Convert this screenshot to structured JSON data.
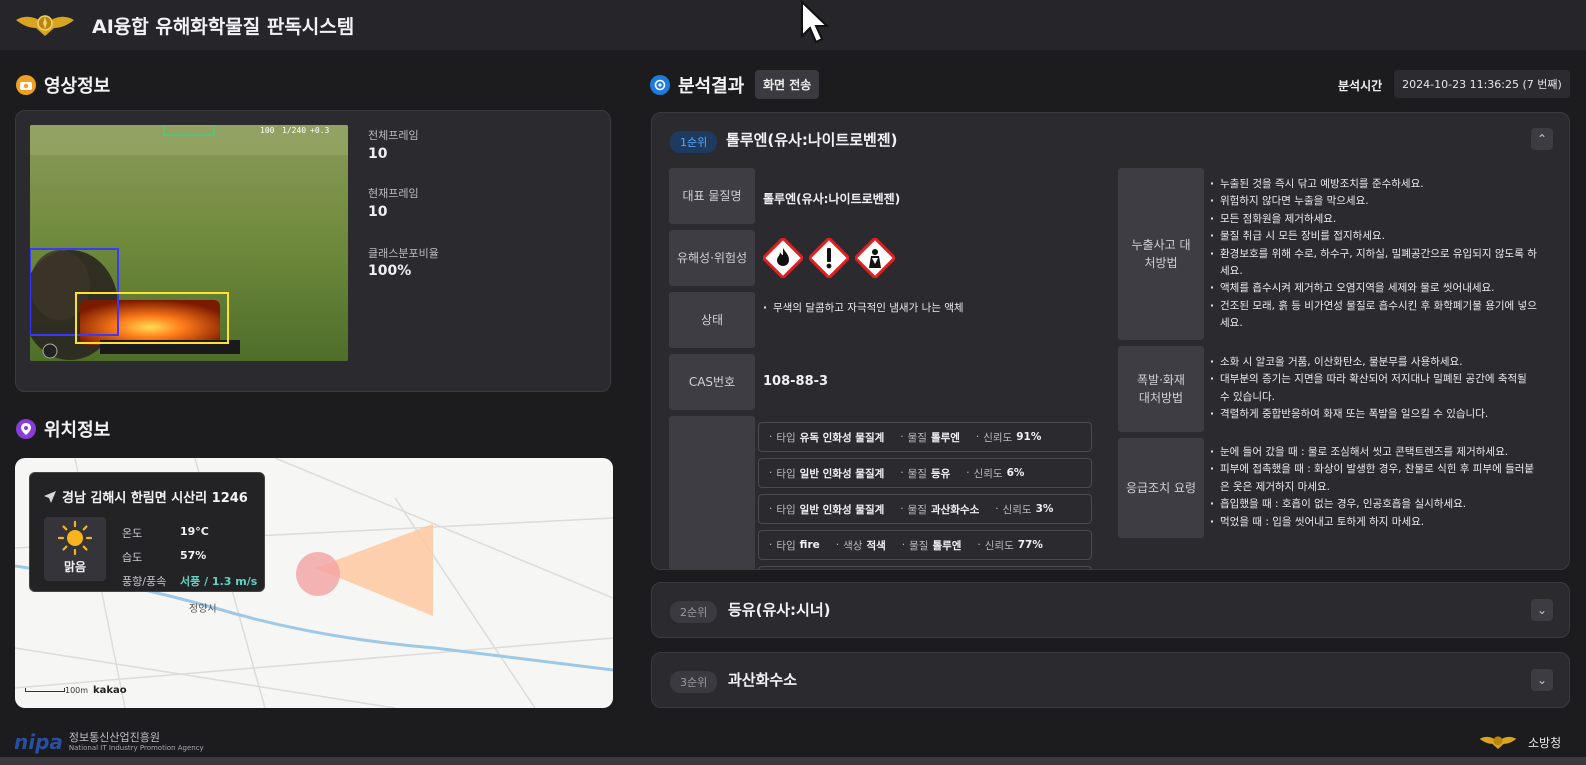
{
  "app": {
    "title": "AI융합 유해화학물질 판독시스템"
  },
  "video_info": {
    "section_title": "영상정보",
    "total_frame_label": "전체프레임",
    "total_frame_value": "10",
    "current_frame_label": "현재프레임",
    "current_frame_value": "10",
    "class_ratio_label": "클래스분포비율",
    "class_ratio_value": "100%",
    "overlay": {
      "shutter": "100",
      "speed": "1/240",
      "ev": "+0.3"
    }
  },
  "location_info": {
    "section_title": "위치정보",
    "address": "경남 김해시 한림면 시산리 1246",
    "weather_label": "맑음",
    "temp_label": "온도",
    "temp_value": "19°C",
    "humidity_label": "습도",
    "humidity_value": "57%",
    "wind_label": "풍향/풍속",
    "wind_value": "서풍 / 1.3 m/s",
    "map_place": "정양시",
    "map_scale": "100m",
    "map_brand": "kakao"
  },
  "analysis": {
    "section_title": "분석결과",
    "send_button": "화면 전송",
    "time_label": "분석시간",
    "time_value": "2024-10-23 11:36:25  (7 번째)",
    "results": [
      {
        "rank": "1순위",
        "name": "톨루엔(유사:나이트로벤젠)",
        "expanded": true,
        "rep_name_label": "대표 물질명",
        "rep_name_value": "톨루엔(유사:나이트로벤젠)",
        "hazard_label": "유해성·위험성",
        "hazard_icons": [
          "flame-icon",
          "exclamation-icon",
          "health-hazard-icon"
        ],
        "state_label": "상태",
        "state_value": "무색의 달콤하고 자극적인 냄새가 나는 액체",
        "cas_label": "CAS번호",
        "cas_value": "108-88-3",
        "leak_label": "누출사고 대처방법",
        "leak_items": [
          "누출된 것을 즉시 닦고 예방조치를 준수하세요.",
          "위험하지 않다면 누출을 막으세요.",
          "모든 점화원을 제거하세요.",
          "물질 취급 시 모든 장비를 접지하세요.",
          "환경보호를 위해 수로, 하수구, 지하실, 밀폐공간으로 유입되지 않도록 하세요.",
          "액체를 흡수시켜 제거하고 오염지역을 세제와 물로 씻어내세요.",
          "건조된 모래, 흙 등 비가연성 물질로 흡수시킨 후 화학폐기물 용기에 넣으세요."
        ],
        "fire_label": "폭발·화재 대처방법",
        "fire_items": [
          "소화 시 알코올 거품, 이산화탄소, 물분무를 사용하세요.",
          "대부분의 증기는 지면을 따라 확산되어 저지대나 밀폐된 공간에 축적될 수 있습니다.",
          "격렬하게 중합반응하여 화재 또는 폭발을 일으킬 수 있습니다."
        ],
        "first_aid_label": "응급조치 요령",
        "first_aid_items": [
          "눈에 들어 갔을 때 : 물로 조심해서 씻고 콘택트렌즈를 제거하세요.",
          "피부에 접촉했을 때 : 화상이 발생한 경우, 찬물로 식힌 후 피부에 들러붙은 옷은 제거하지 마세요.",
          "흡입했을 때 : 호흡이 없는 경우, 인공호흡을 실시하세요.",
          "먹었을 때 : 입을 씻어내고 토하게 하지 마세요."
        ],
        "detections": [
          {
            "type_label": "타입",
            "type": "유독 인화성 물질계",
            "mat_label": "물질",
            "mat": "톨루엔",
            "conf_label": "신뢰도",
            "conf": "91%"
          },
          {
            "type_label": "타입",
            "type": "일반 인화성 물질계",
            "mat_label": "물질",
            "mat": "등유",
            "conf_label": "신뢰도",
            "conf": "6%"
          },
          {
            "type_label": "타입",
            "type": "일반 인화성 물질계",
            "mat_label": "물질",
            "mat": "과산화수소",
            "conf_label": "신뢰도",
            "conf": "3%"
          },
          {
            "type_label": "타입",
            "type": "fire",
            "color_label": "색상",
            "color": "적색",
            "mat_label": "물질",
            "mat": "톨루엔",
            "conf_label": "신뢰도",
            "conf": "77%"
          }
        ]
      },
      {
        "rank": "2순위",
        "name": "등유(유사:시너)",
        "expanded": false
      },
      {
        "rank": "3순위",
        "name": "과산화수소",
        "expanded": false
      }
    ]
  },
  "footer": {
    "nipa_logo": "nipa",
    "nipa_name": "정보통신산업진흥원",
    "nipa_en": "National IT Industry Promotion Agency",
    "fire_agency": "소방청"
  },
  "colors": {
    "accent_blue": "#5ca8ff",
    "wind_teal": "#5fd3c4",
    "bg": "#1c1c1f",
    "panel": "#2b2b2f"
  }
}
